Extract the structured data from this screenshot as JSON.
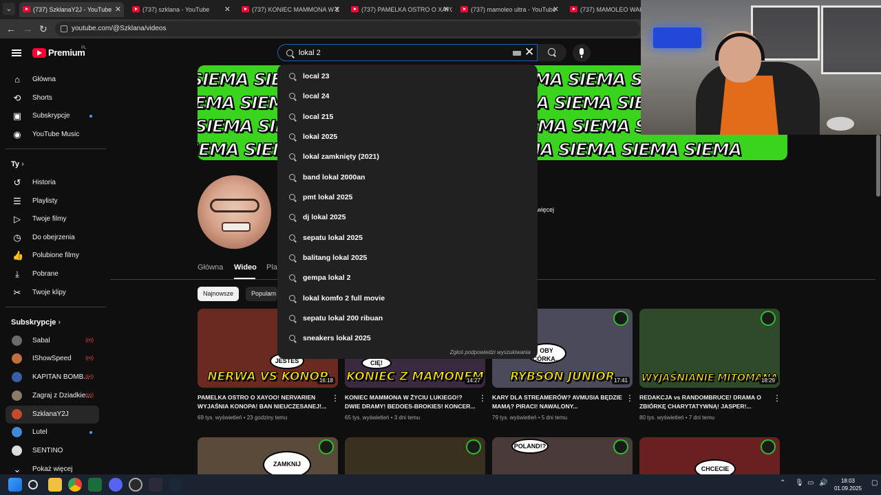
{
  "browser": {
    "tabs": [
      {
        "label": "(737) SzklanaY2J - YouTube",
        "active": true
      },
      {
        "label": "(737) szklana - YouTube",
        "active": false
      },
      {
        "label": "(737) KONIEC MAMMONA W Z",
        "active": false
      },
      {
        "label": "(737) PAMELKA OSTRO O XAYO",
        "active": false
      },
      {
        "label": "(737) mamoleo ultra - YouTube",
        "active": false
      },
      {
        "label": "(737) MAMOLEO WAKAC",
        "active": false
      }
    ],
    "url": "youtube.com/@Szklana/videos"
  },
  "header": {
    "brand": "Premium",
    "country": "PL",
    "search_value": "lokal 2"
  },
  "sidebar": {
    "main": [
      {
        "label": "Główna",
        "icon": "home-icon"
      },
      {
        "label": "Shorts",
        "icon": "shorts-icon"
      },
      {
        "label": "Subskrypcje",
        "icon": "subscriptions-icon",
        "dot": true
      },
      {
        "label": "YouTube Music",
        "icon": "music-icon"
      }
    ],
    "you_heading": "Ty",
    "you": [
      {
        "label": "Historia",
        "icon": "history-icon"
      },
      {
        "label": "Playlisty",
        "icon": "playlist-icon"
      },
      {
        "label": "Twoje filmy",
        "icon": "your-videos-icon"
      },
      {
        "label": "Do obejrzenia",
        "icon": "clock-icon"
      },
      {
        "label": "Polubione filmy",
        "icon": "thumb-up-icon"
      },
      {
        "label": "Pobrane",
        "icon": "download-icon"
      },
      {
        "label": "Twoje klipy",
        "icon": "scissors-icon"
      }
    ],
    "subs_heading": "Subskrypcje",
    "subs": [
      {
        "label": "Sabal",
        "color": "#6b6b6b",
        "live": true
      },
      {
        "label": "IShowSpeed",
        "color": "#c0703a",
        "live": true
      },
      {
        "label": "KAPITAN BOMB...",
        "color": "#3b5ea8",
        "live": true
      },
      {
        "label": "Zagraj z Dziadkie...",
        "color": "#8a7a6a",
        "live": true
      },
      {
        "label": "SzklanaY2J",
        "color": "#c44a2a",
        "selected": true
      },
      {
        "label": "Lutel",
        "color": "#3f8ad6",
        "dot": true
      },
      {
        "label": "SENTINO",
        "color": "#dddddd"
      }
    ],
    "show_more": "Pokaż więcej"
  },
  "channel": {
    "banner_text": "SIEMA SIEMA SIEMA SIEMA SIEMA SIEMA SIEMA SIEMA SIEMA",
    "more_link": "więcej",
    "tabs": [
      "Główna",
      "Wideo",
      "Pla"
    ],
    "chips": [
      "Najnowsze",
      "Popularn"
    ]
  },
  "suggestions": {
    "items": [
      "local 23",
      "local 24",
      "local 215",
      "lokal 2025",
      "lokal zamknięty (2021)",
      "band lokal 2000an",
      "pmt lokal 2025",
      "dj lokal 2025",
      "sepatu lokal 2025",
      "balitang lokal 2025",
      "gempa lokal 2",
      "lokal komfo 2 full movie",
      "sepatu lokal 200 ribuan",
      "sneakers lokal 2025"
    ],
    "report": "Zgłoś podpowiedzi wyszukiwania"
  },
  "videos": [
    {
      "thumb_text": "NERWA VS KONOP",
      "duration": "16:18",
      "title": "PAMELKA OSTRO O XAYOO! NERVARIEN WYJAŚNIA KONOPA! BAN NIEUCZESANEJ!...",
      "views": "69 tys. wyświetleń",
      "age": "23 godziny temu",
      "bg": "#6a2a22",
      "bubble": "JESTEŚ"
    },
    {
      "thumb_text": "KONIEC Z MAMONEM",
      "duration": "14:27",
      "title": "KONIEC MAMMONA W ŻYCIU LUKIEGO!? DWIE DRAMY! BEDOES-BROKIES! KONCER...",
      "views": "65 tys. wyświetleń",
      "age": "3 dni temu",
      "bg": "#3a2a40",
      "bubble": "CIĘ!"
    },
    {
      "thumb_text": "RYBSON JUNIOR",
      "duration": "17:41",
      "title": "KARY DLA STREAMERÓW? AVMUSIA BĘDZIE MAMĄ? PIRACI! NAWALONY...",
      "views": "79 tys. wyświetleń",
      "age": "5 dni temu",
      "bg": "#4a4a5a",
      "bubble": "OBY CÓRKA..."
    },
    {
      "thumb_text": "WYJAŚNIANIE MITOMANA",
      "duration": "18:29",
      "title": "REDAKCJA vs RANDOMBRUCE! DRAMA O ZBIÓRKĘ CHARYTATYWNĄ! JASPER!...",
      "views": "80 tys. wyświetleń",
      "age": "7 dni temu",
      "bg": "#2e4a2a",
      "bubble": ""
    }
  ],
  "row2": [
    {
      "bubble": "ZAMKNIJ",
      "bg": "#5a4a3a"
    },
    {
      "bubble": "",
      "bg": "#3a3020"
    },
    {
      "bubble": "POLAND!?",
      "bg": "#4a3a3a"
    },
    {
      "bubble": "CHCECIE",
      "bg": "#6a2020"
    }
  ],
  "taskbar": {
    "time": "18:03",
    "date": "01.09.2025"
  }
}
